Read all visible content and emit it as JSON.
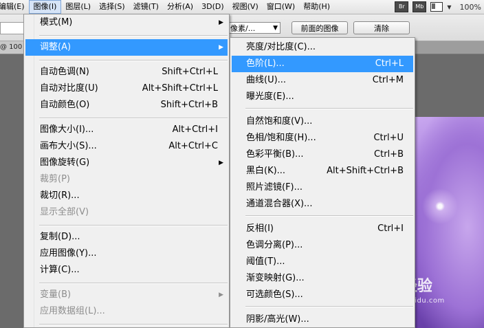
{
  "menubar": {
    "items": [
      "编辑(E)",
      "图像(I)",
      "图层(L)",
      "选择(S)",
      "滤镜(T)",
      "分析(A)",
      "3D(D)",
      "视图(V)",
      "窗口(W)",
      "帮助(H)"
    ],
    "badges": [
      "Br",
      "Mb"
    ],
    "zoom": "100%"
  },
  "options": {
    "select_value": "像素/...",
    "front_image_button": "前面的图像",
    "clear_button": "清除"
  },
  "doc_tab": "@ 100",
  "watermark": {
    "brand": "Bai 经验",
    "url": "jingyan.baidu.com"
  },
  "image_menu": {
    "items": [
      {
        "label": "模式(M)",
        "shortcut": "",
        "submenu": true
      },
      {
        "label": "调整(A)",
        "shortcut": "",
        "submenu": true,
        "active": true
      },
      {
        "label": "自动色调(N)",
        "shortcut": "Shift+Ctrl+L"
      },
      {
        "label": "自动对比度(U)",
        "shortcut": "Alt+Shift+Ctrl+L"
      },
      {
        "label": "自动颜色(O)",
        "shortcut": "Shift+Ctrl+B"
      },
      {
        "label": "图像大小(I)...",
        "shortcut": "Alt+Ctrl+I"
      },
      {
        "label": "画布大小(S)...",
        "shortcut": "Alt+Ctrl+C"
      },
      {
        "label": "图像旋转(G)",
        "shortcut": "",
        "submenu": true
      },
      {
        "label": "裁剪(P)",
        "shortcut": "",
        "disabled": true
      },
      {
        "label": "裁切(R)...",
        "shortcut": ""
      },
      {
        "label": "显示全部(V)",
        "shortcut": "",
        "disabled": true
      },
      {
        "label": "复制(D)...",
        "shortcut": ""
      },
      {
        "label": "应用图像(Y)...",
        "shortcut": ""
      },
      {
        "label": "计算(C)...",
        "shortcut": ""
      },
      {
        "label": "变量(B)",
        "shortcut": "",
        "submenu": true,
        "disabled": true
      },
      {
        "label": "应用数据组(L)...",
        "shortcut": "",
        "disabled": true
      }
    ]
  },
  "adjust_menu": {
    "items": [
      {
        "label": "亮度/对比度(C)...",
        "shortcut": ""
      },
      {
        "label": "色阶(L)...",
        "shortcut": "Ctrl+L",
        "active": true
      },
      {
        "label": "曲线(U)...",
        "shortcut": "Ctrl+M"
      },
      {
        "label": "曝光度(E)...",
        "shortcut": ""
      },
      {
        "label": "自然饱和度(V)...",
        "shortcut": ""
      },
      {
        "label": "色相/饱和度(H)...",
        "shortcut": "Ctrl+U"
      },
      {
        "label": "色彩平衡(B)...",
        "shortcut": "Ctrl+B"
      },
      {
        "label": "黑白(K)...",
        "shortcut": "Alt+Shift+Ctrl+B"
      },
      {
        "label": "照片滤镜(F)...",
        "shortcut": ""
      },
      {
        "label": "通道混合器(X)...",
        "shortcut": ""
      },
      {
        "label": "反相(I)",
        "shortcut": "Ctrl+I"
      },
      {
        "label": "色调分离(P)...",
        "shortcut": ""
      },
      {
        "label": "阈值(T)...",
        "shortcut": ""
      },
      {
        "label": "渐变映射(G)...",
        "shortcut": ""
      },
      {
        "label": "可选颜色(S)...",
        "shortcut": ""
      },
      {
        "label": "阴影/高光(W)...",
        "shortcut": ""
      }
    ]
  },
  "colors": {
    "highlight": "#3399ff",
    "menu_bg": "#f0f0f0",
    "disabled_text": "#8d8d8d"
  }
}
